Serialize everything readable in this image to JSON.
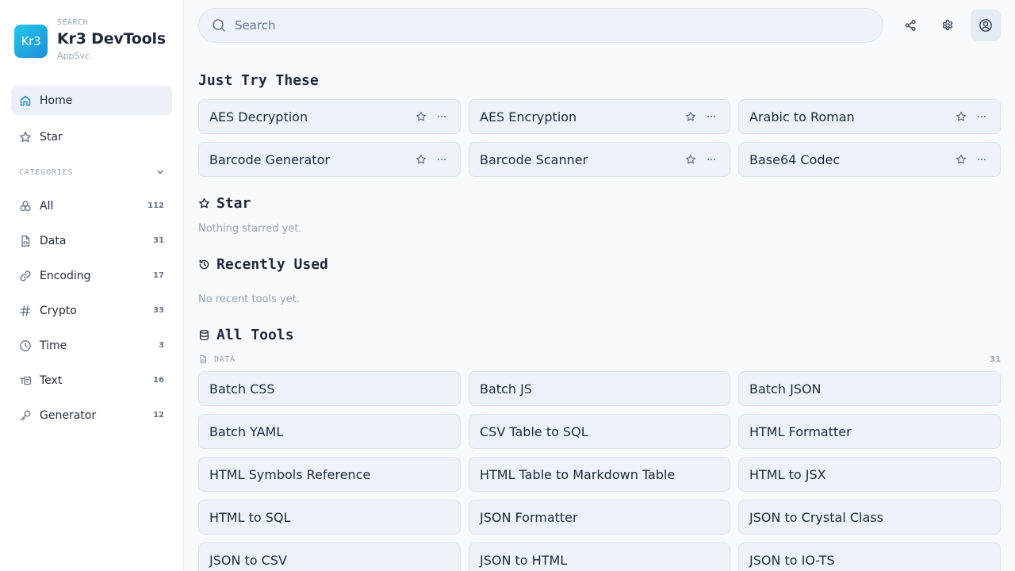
{
  "brand": {
    "logo_text": "Kr3",
    "kicker": "SEARCH",
    "title": "Kr3 DevTools",
    "subtitle": "AppSvc"
  },
  "sidebar": {
    "nav": [
      {
        "label": "Home",
        "icon": "home-icon",
        "active": true
      },
      {
        "label": "Star",
        "icon": "star-icon",
        "active": false
      }
    ],
    "categories_label": "CATEGORIES",
    "categories": [
      {
        "label": "All",
        "count": "112",
        "icon": "all-categories-icon"
      },
      {
        "label": "Data",
        "count": "31",
        "icon": "file-code-icon"
      },
      {
        "label": "Encoding",
        "count": "17",
        "icon": "link-icon"
      },
      {
        "label": "Crypto",
        "count": "33",
        "icon": "hash-icon"
      },
      {
        "label": "Time",
        "count": "3",
        "icon": "clock-icon"
      },
      {
        "label": "Text",
        "count": "16",
        "icon": "text-icon"
      },
      {
        "label": "Generator",
        "count": "12",
        "icon": "key-icon"
      }
    ]
  },
  "topbar": {
    "search_placeholder": "Search",
    "buttons": [
      "share-icon",
      "gear-icon",
      "user-circle-icon"
    ]
  },
  "sections": {
    "try_title": "Just Try These",
    "try_tools": [
      "AES Decryption",
      "AES Encryption",
      "Arabic to Roman",
      "Barcode Generator",
      "Barcode Scanner",
      "Base64 Codec"
    ],
    "star_title": "Star",
    "star_empty": "Nothing starred yet.",
    "recent_title": "Recently Used",
    "recent_empty": "No recent tools yet.",
    "all_title": "All Tools",
    "data_group": {
      "label": "DATA",
      "count": "31",
      "tools": [
        "Batch CSS",
        "Batch JS",
        "Batch JSON",
        "Batch YAML",
        "CSV Table to SQL",
        "HTML Formatter",
        "HTML Symbols Reference",
        "HTML Table to Markdown Table",
        "HTML to JSX",
        "HTML to SQL",
        "JSON Formatter",
        "JSON to Crystal Class",
        "JSON to CSV",
        "JSON to HTML",
        "JSON to IO-TS"
      ]
    }
  },
  "colors": {
    "accent": "#1f8fd9",
    "active_bg": "#ecf1f8",
    "card_bg": "#edf2f9",
    "muted": "#94a3b8"
  }
}
